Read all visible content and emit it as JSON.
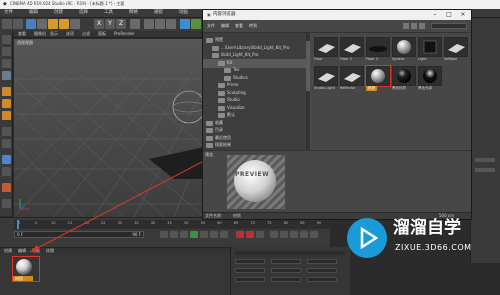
{
  "window": {
    "title": "CINEMA 4D R19.024 Studio (RC - R19) - [未标题 1 *] - 主要"
  },
  "menu": [
    "文件",
    "编辑",
    "创建",
    "选择",
    "工具",
    "网格",
    "捕捉",
    "动画",
    "模拟",
    "渲染",
    "雕刻",
    "运动跟踪",
    "运动图形",
    "角色",
    "流水线",
    "插件",
    "脚本",
    "窗口",
    "帮助"
  ],
  "toolbar": {
    "coords_labels": [
      "X",
      "Y",
      "Z"
    ]
  },
  "viewport_menu": [
    "查看",
    "摄像机",
    "显示",
    "选项",
    "过滤",
    "面板",
    "ProRender"
  ],
  "viewport_label": "透视视图",
  "dialog": {
    "title": "内容浏览器",
    "menu": [
      "文件",
      "编辑",
      "查看",
      "转到"
    ],
    "tree": [
      {
        "label": "预置",
        "indent": 0,
        "selected": false
      },
      {
        "label": "...\\User\\Library\\lib4d_Light_Kit_Pro",
        "indent": 1,
        "selected": false
      },
      {
        "label": "lib4d_Light_Kit_Pro",
        "indent": 1,
        "selected": false
      },
      {
        "label": "Kit",
        "indent": 2,
        "selected": true
      },
      {
        "label": "Tex",
        "indent": 3,
        "selected": false
      },
      {
        "label": "Studios",
        "indent": 3,
        "selected": false
      },
      {
        "label": "Prime",
        "indent": 2,
        "selected": false
      },
      {
        "label": "Sculpting",
        "indent": 2,
        "selected": false
      },
      {
        "label": "Studio",
        "indent": 2,
        "selected": false
      },
      {
        "label": "Visualize",
        "indent": 2,
        "selected": false
      },
      {
        "label": "默认",
        "indent": 2,
        "selected": false
      },
      {
        "label": "收藏",
        "indent": 0,
        "selected": false
      },
      {
        "label": "目录",
        "indent": 0,
        "selected": false
      },
      {
        "label": "最近使用",
        "indent": 0,
        "selected": false
      },
      {
        "label": "搜索结果",
        "indent": 0,
        "selected": false
      }
    ],
    "grid_items": [
      {
        "label": "Floor",
        "kind": "flat"
      },
      {
        "label": "Floor 2",
        "kind": "flat"
      },
      {
        "label": "Floor 3",
        "kind": "disc"
      },
      {
        "label": "Sphere",
        "kind": "sphere"
      },
      {
        "label": "Light",
        "kind": "dark"
      },
      {
        "label": "Softbox",
        "kind": "flat"
      },
      {
        "label": "Studio Light",
        "kind": "flat"
      },
      {
        "label": "Reflector",
        "kind": "flat"
      },
      {
        "label": "材质",
        "kind": "sphere"
      },
      {
        "label": "黑色材质",
        "kind": "darksphere"
      },
      {
        "label": "黑色光泽",
        "kind": "darksphere2"
      }
    ],
    "preview_left_label": "预览",
    "preview_text": "PREVIEW",
    "status_left": "文件名称:",
    "status_value": "材质",
    "status_right": "500 cm"
  },
  "timeline": {
    "frames": [
      "0",
      "5",
      "10",
      "15",
      "20",
      "25",
      "30",
      "35",
      "40",
      "45",
      "50",
      "55",
      "60",
      "65",
      "70",
      "75",
      "80",
      "85",
      "90"
    ],
    "start": "0 F",
    "end": "90 F"
  },
  "material_manager": {
    "menu": [
      "创建",
      "编辑",
      "功能",
      "纹理"
    ],
    "material_label": "材质"
  },
  "watermark": {
    "brand": "溜溜自学",
    "url": "ZIXUE.3D66.COM"
  },
  "colors": {
    "accent_blue": "#1a9bd7",
    "highlight_red": "#e0362a",
    "dialog_bg": "#4d4d4d"
  }
}
